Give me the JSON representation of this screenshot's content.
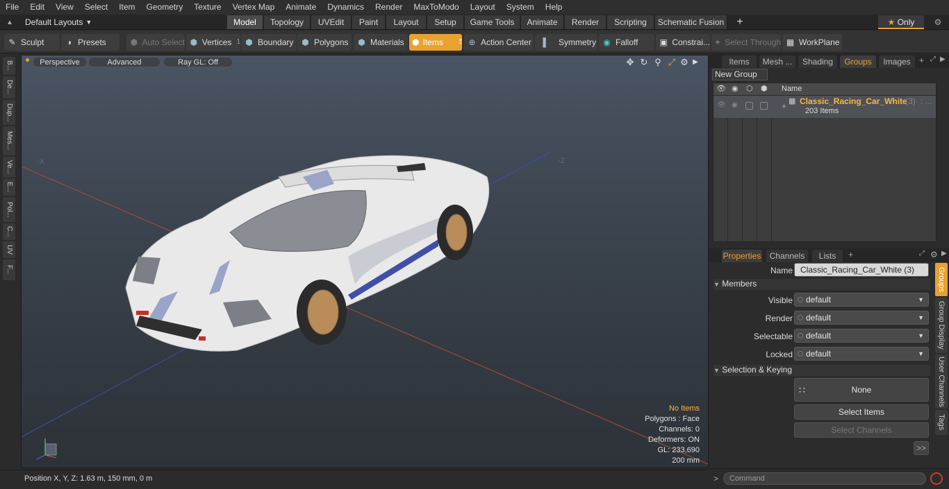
{
  "menu": [
    "File",
    "Edit",
    "View",
    "Select",
    "Item",
    "Geometry",
    "Texture",
    "Vertex Map",
    "Animate",
    "Dynamics",
    "Render",
    "MaxToModo",
    "Layout",
    "System",
    "Help"
  ],
  "layouts": {
    "dropdown": "Default Layouts",
    "tabs": [
      "Model",
      "Topology",
      "UVEdit",
      "Paint",
      "Layout",
      "Setup",
      "Game Tools",
      "Animate",
      "Render",
      "Scripting",
      "Schematic Fusion"
    ],
    "active": "Model",
    "only": "Only"
  },
  "toolbar": {
    "sculpt": "Sculpt",
    "presets": "Presets",
    "auto_select": "Auto Select",
    "vertices": "Vertices",
    "vertices_count": "1",
    "boundary": "Boundary",
    "polygons": "Polygons",
    "materials": "Materials",
    "items": "Items",
    "items_count": "5",
    "action_center": "Action Center",
    "symmetry": "Symmetry",
    "falloff": "Falloff",
    "constraints": "Constrai...",
    "select_through": "Select Through",
    "workplane": "WorkPlane"
  },
  "left_tabs": [
    "B...",
    "De...",
    "Dup...",
    "Mes...",
    "Ve...",
    "E...",
    "Pol...",
    "C...",
    "UV",
    "F..."
  ],
  "viewport": {
    "view": "Perspective",
    "shading": "Advanced",
    "raygl": "Ray GL: Off",
    "axis_x_left": "-X",
    "axis_z_right": "-Z",
    "stats": {
      "items": "No Items",
      "polygons": "Polygons : Face",
      "channels": "Channels: 0",
      "deformers": "Deformers: ON",
      "gl": "GL: 233,690",
      "grid": "200 mm"
    }
  },
  "status": {
    "position": "Position X, Y, Z:   1.63 m, 150 mm, 0 m"
  },
  "groups_panel": {
    "tabs": [
      "Items",
      "Mesh ...",
      "Shading",
      "Groups",
      "Images"
    ],
    "active": "Groups",
    "new_group": "New Group",
    "col_name": "Name",
    "group_name": "Classic_Racing_Car_White",
    "group_count": "(3)",
    "group_ellipsis": ": ...",
    "group_items": "203 Items"
  },
  "properties": {
    "tabs": [
      "Properties",
      "Channels",
      "Lists"
    ],
    "active": "Properties",
    "name_label": "Name",
    "name_value": "Classic_Racing_Car_White (3)",
    "members": "Members",
    "visible_label": "Visible",
    "visible": "default",
    "render_label": "Render",
    "render": "default",
    "selectable_label": "Selectable",
    "selectable": "default",
    "locked_label": "Locked",
    "locked": "default",
    "sel_keying": "Selection & Keying",
    "none": "None",
    "select_items": "Select Items",
    "select_channels": "Select Channels",
    "more": ">>",
    "side_tabs": [
      "Groups",
      "Group Display",
      "User Channels",
      "Tags"
    ]
  },
  "command": {
    "placeholder": "Command"
  }
}
